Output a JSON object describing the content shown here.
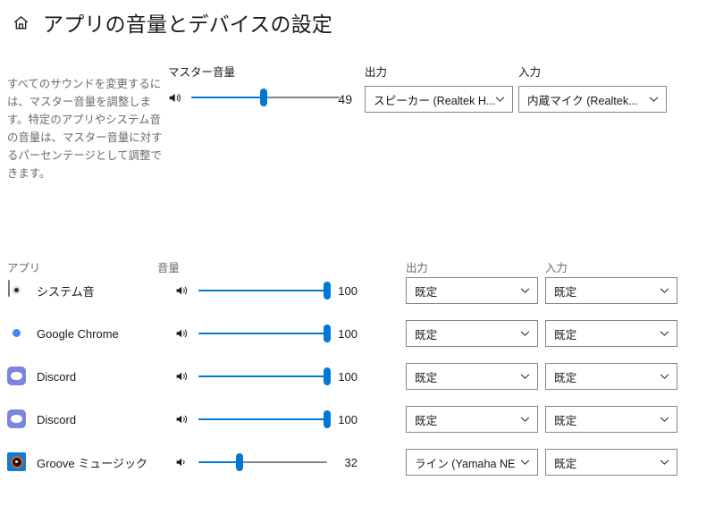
{
  "header": {
    "home_icon": "home-icon",
    "title": "アプリの音量とデバイスの設定"
  },
  "description": "すべてのサウンドを変更するには、マスター音量を調整します。特定のアプリやシステム音の音量は、マスター音量に対するパーセンテージとして調整できます。",
  "master": {
    "label": "マスター音量",
    "speaker_icon": "speaker-icon",
    "value": "49",
    "percent": 49
  },
  "device": {
    "output_label": "出力",
    "output_value": "スピーカー (Realtek H...",
    "input_label": "入力",
    "input_value": "内蔵マイク (Realtek...",
    "chevron_icon": "chevron-down-icon"
  },
  "app_section": {
    "app_header": "アプリ",
    "volume_header": "音量",
    "output_header": "出力",
    "input_header": "入力"
  },
  "apps": [
    {
      "icon": "system-sound-icon",
      "name": "システム音",
      "value": "100",
      "percent": 100,
      "output": "既定",
      "input": "既定"
    },
    {
      "icon": "chrome-icon",
      "name": "Google Chrome",
      "value": "100",
      "percent": 100,
      "output": "既定",
      "input": "既定"
    },
    {
      "icon": "discord-icon",
      "name": "Discord",
      "value": "100",
      "percent": 100,
      "output": "既定",
      "input": "既定"
    },
    {
      "icon": "discord-icon",
      "name": "Discord",
      "value": "100",
      "percent": 100,
      "output": "既定",
      "input": "既定"
    },
    {
      "icon": "groove-icon",
      "name": "Groove ミュージック",
      "value": "32",
      "percent": 32,
      "output": "ライン (Yamaha NE",
      "input": "既定"
    }
  ],
  "colors": {
    "accent": "#0078d4",
    "track": "#868686",
    "muted_text": "#6b6b6b",
    "border": "#868686"
  }
}
